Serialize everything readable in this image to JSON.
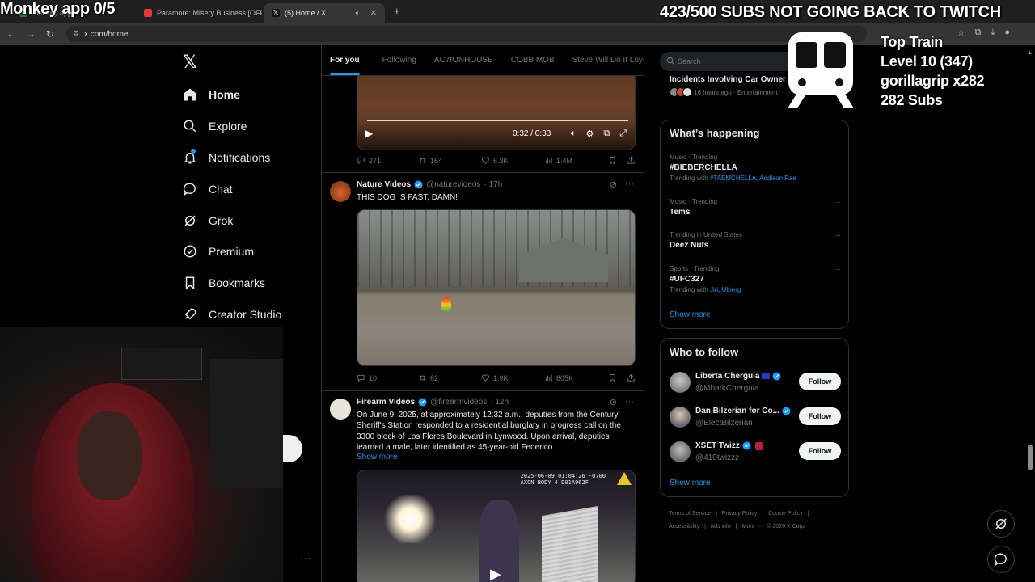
{
  "stream": {
    "left_overlay": "Monkey app 0/5",
    "right_overlay": "423/500 SUBS NOT GOING BACK TO TWITCH",
    "train_title": "Top Train",
    "train_level": "Level 10  (347)",
    "train_user": "gorillagrip x282",
    "train_subs": "282 Subs"
  },
  "browser": {
    "tabs": [
      {
        "label": "Monkey app",
        "active": false
      },
      {
        "label": "Paramore: Misery Business [OFF",
        "active": false
      },
      {
        "label": "(5) Home / X",
        "active": true
      }
    ],
    "url": "x.com/home"
  },
  "sidebar": {
    "items": [
      {
        "label": "Home"
      },
      {
        "label": "Explore"
      },
      {
        "label": "Notifications"
      },
      {
        "label": "Chat"
      },
      {
        "label": "Grok"
      },
      {
        "label": "Premium"
      },
      {
        "label": "Bookmarks"
      },
      {
        "label": "Creator Studio"
      }
    ]
  },
  "timeline": {
    "tabs": [
      "For you",
      "Following",
      "AC7IONHOUSE",
      "COBB MOB",
      "Steve Will Do It Loyal"
    ],
    "post0": {
      "timecode": "0:32 / 0:33",
      "replies": "271",
      "reposts": "164",
      "likes": "6.3K",
      "views": "1.4M"
    },
    "post1": {
      "name": "Nature Videos",
      "handle": "@naturevideos",
      "time": "· 17h",
      "text": "THIS DOG IS FAST, DAMN!",
      "replies": "10",
      "reposts": "62",
      "likes": "1.9K",
      "views": "805K"
    },
    "post2": {
      "name": "Firearm Videos",
      "handle": "@firearmvideos",
      "time": "· 12h",
      "text": "On June 9, 2025, at approximately 12:32 a.m., deputies from the Century Sheriff's Station responded to a residential burglary in progress call on the 3300 block of Los Flores Boulevard in Lynwood. Upon arrival, deputies learned a male, later identified as 45-year-old Federico",
      "show_more": "Show more",
      "bodycam_line1": "2025-06-09 01:04:26 -0700",
      "bodycam_line2": "AXON BODY 4 D01A962F"
    }
  },
  "right": {
    "search_placeholder": "Search",
    "prev_card_title": "Incidents Involving Car Owner",
    "prev_card_meta": "16 hours ago · Entertainment",
    "whats_happening": "What’s happening",
    "trends": [
      {
        "category": "Music · Trending",
        "title": "#BIEBERCHELLA",
        "with_prefix": "Trending with",
        "with": "#TAEMCHELLA, Addison Rae"
      },
      {
        "category": "Music · Trending",
        "title": "Tems"
      },
      {
        "category": "Trending in United States",
        "title": "Deez Nuts"
      },
      {
        "category": "Sports · Trending",
        "title": "#UFC327",
        "with_prefix": "Trending with",
        "with": "Jiri, Ulberg"
      }
    ],
    "show_more": "Show more",
    "who_to_follow": "Who to follow",
    "follow": [
      {
        "name": "Liberta Cherguia",
        "handle": "@MbarkCherguia",
        "button": "Follow"
      },
      {
        "name": "Dan Bilzerian for Co...",
        "handle": "@ElectBilzerian",
        "button": "Follow"
      },
      {
        "name": "XSET Twizz",
        "handle": "@419twizzz",
        "button": "Follow"
      }
    ],
    "show_more_2": "Show more",
    "footer": [
      "Terms of Service",
      "|",
      "Privacy Policy",
      "|",
      "Cookie Policy",
      "|",
      "Accessibility",
      "|",
      "Ads info",
      "|",
      "More ···",
      "© 2026 X Corp."
    ]
  },
  "colors": {
    "accent": "#1d9bf0",
    "background": "#000000",
    "border": "#2f3336"
  }
}
